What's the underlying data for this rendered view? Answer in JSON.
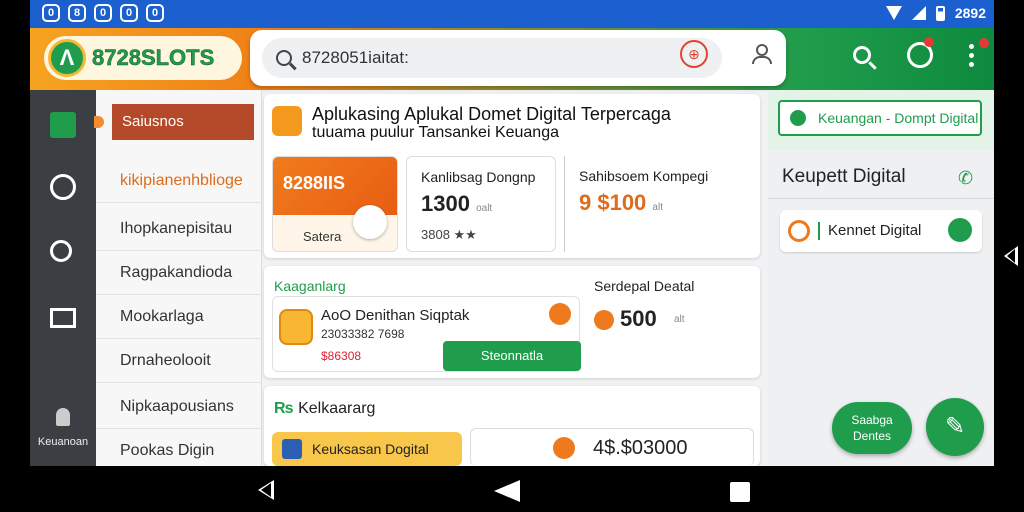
{
  "status_bar": {
    "left_icons": [
      "0",
      "8",
      "0",
      "0",
      "0"
    ],
    "time": "2892"
  },
  "header": {
    "logo_text": "8728SLOTS",
    "search_value": "8728051iaitat:"
  },
  "sidebar": {
    "selected": "Saiusnos",
    "items": [
      "kikipianenhblioge",
      "Ihopkanepisitau",
      "Ragpakandioda",
      "Mookarlaga",
      "Drnaheolooit",
      "Nipkaapousians",
      "Pookas Digin"
    ],
    "rail_label": "Keuanoan"
  },
  "main": {
    "hero": {
      "title": "Aplukasing Aplukal Domet Digital Terpercaga",
      "subtitle": "tuuama puulur Tansankei Keuanga",
      "promo_title": "8288IIS",
      "promo_caption": "Satera",
      "stat1_label": "Kanlibsag Dongnp",
      "stat1_value": "1300",
      "stat1_unit": "oalt",
      "stat1_sub": "3808 ★★",
      "stat2_label": "Sahibsoem Kompegi",
      "stat2_value": "9 $100",
      "stat2_unit": "alt"
    },
    "card2": {
      "header": "Kaaganlarg",
      "item_title": "AoO Denithan Siqptak",
      "item_code": "23033382 7698",
      "item_price": "$86308",
      "button": "Steonnatla",
      "right_label": "Serdepal Deatal",
      "right_value": "500",
      "right_unit": "alt"
    },
    "card3": {
      "header": "Kelkaararg",
      "pill_label": "Keuksasan Dogital",
      "value": "4$.$03000"
    }
  },
  "right_panel": {
    "top_button": "Keuangan - Dompt Digital",
    "heading": "Keupett Digital",
    "item": "Kennet Digital",
    "fab_label": "Saabga Dentes"
  },
  "colors": {
    "brand_green": "#1f9d4c",
    "brand_orange": "#ef7f16",
    "status_blue": "#1c5fcf"
  }
}
